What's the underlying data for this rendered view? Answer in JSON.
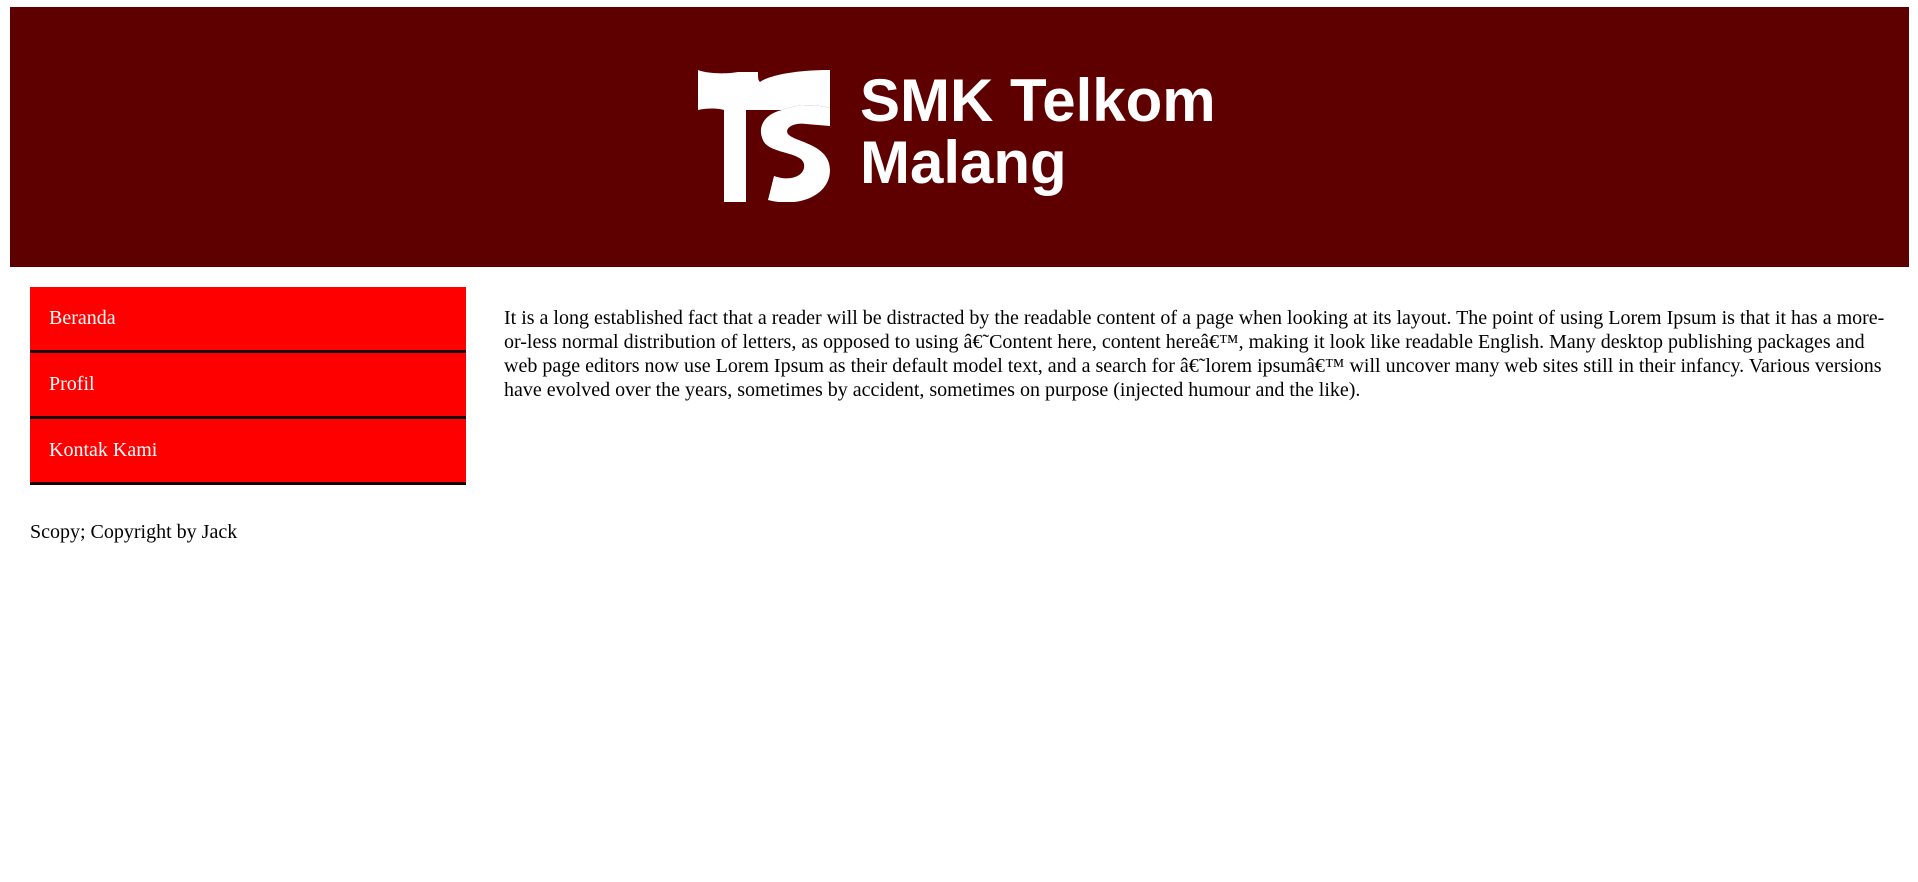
{
  "header": {
    "logo_line1": "SMK Telkom",
    "logo_line2": "Malang",
    "background": "#5e0000"
  },
  "sidebar": {
    "items": [
      {
        "label": "Beranda"
      },
      {
        "label": "Profil"
      },
      {
        "label": "Kontak Kami"
      }
    ],
    "item_color": "#ff0000"
  },
  "main": {
    "paragraph": "It is a long established fact that a reader will be distracted by the readable content of a page when looking at its layout. The point of using Lorem Ipsum is that it has a more-or-less normal distribution of letters, as opposed to using â€˜Content here, content hereâ€™, making it look like readable English. Many desktop publishing packages and web page editors now use Lorem Ipsum as their default model text, and a search for â€˜lorem ipsumâ€™ will uncover many web sites still in their infancy. Various versions have evolved over the years, sometimes by accident, sometimes on purpose (injected humour and the like)."
  },
  "footer": {
    "text": "Scopy; Copyright by Jack"
  }
}
